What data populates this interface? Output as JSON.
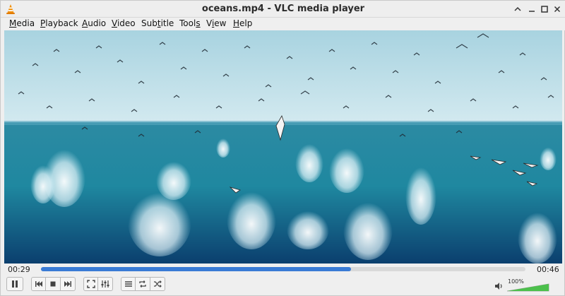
{
  "window": {
    "title": "oceans.mp4 - VLC media player",
    "app_icon": "vlc-cone-icon"
  },
  "menubar": {
    "items": [
      {
        "label": "Media",
        "hotkey": "M"
      },
      {
        "label": "Playback",
        "hotkey": "P"
      },
      {
        "label": "Audio",
        "hotkey": "A"
      },
      {
        "label": "Video",
        "hotkey": "V"
      },
      {
        "label": "Subtitle",
        "hotkey": "t"
      },
      {
        "label": "Tools",
        "hotkey": "s"
      },
      {
        "label": "View",
        "hotkey": "i"
      },
      {
        "label": "Help",
        "hotkey": "H"
      }
    ]
  },
  "player": {
    "elapsed": "00:29",
    "remaining": "00:46",
    "progress_fraction": 0.64,
    "volume_label": "100%",
    "volume_fraction": 1.0
  },
  "controls": {
    "icons": [
      "pause-icon",
      "previous-icon",
      "stop-icon",
      "next-icon",
      "fullscreen-icon",
      "extended-settings-icon",
      "playlist-icon",
      "loop-icon",
      "shuffle-icon",
      "volume-icon"
    ]
  },
  "colors": {
    "accent": "#3a7bd5",
    "volume_green": "#4cc04c"
  }
}
